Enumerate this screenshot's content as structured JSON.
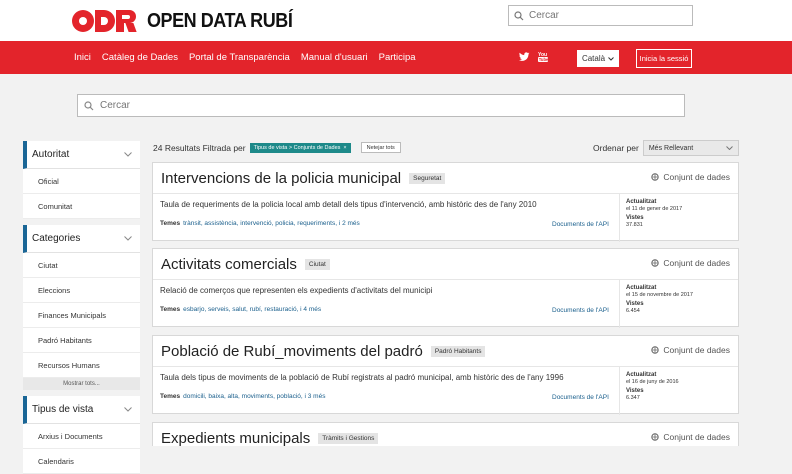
{
  "header": {
    "logo_text": "OPEN DATA RUBÍ",
    "search_placeholder": "Cercar"
  },
  "nav": {
    "items": [
      "Inici",
      "Catàleg de Dades",
      "Portal de Transparència",
      "Manual d'usuari",
      "Participa"
    ],
    "language": "Català",
    "login": "Inicia la sessió"
  },
  "main_search": {
    "placeholder": "Cercar"
  },
  "sidebar": {
    "facets": [
      {
        "title": "Autoritat",
        "items": [
          "Oficial",
          "Comunitat"
        ]
      },
      {
        "title": "Categories",
        "items": [
          "Ciutat",
          "Eleccions",
          "Finances Municipals",
          "Padró Habitants",
          "Recursos Humans"
        ],
        "show_all": "Mostrar tots..."
      },
      {
        "title": "Tipus de vista",
        "items": [
          "Arxius i Documents",
          "Calendaris"
        ]
      }
    ]
  },
  "results": {
    "count_text": "24 Resultats Filtrada per",
    "filter_chip": "Tipus de vista > Conjunts de Dades",
    "clear_label": "Netejar tots",
    "order_label": "Ordenar per",
    "order_value": "Més Rellevant"
  },
  "cards": [
    {
      "title": "Intervencions de la policia municipal",
      "tag": "Seguretat",
      "type": "Conjunt de dades",
      "description": "Taula de requeriments de la policia local amb detall dels tipus d'intervenció, amb històric des de l'any 2010",
      "temes_label": "Temes",
      "temes": "trànsit, assistència, intervenció, policia, requeriments, i 2 més",
      "api": "Documents de l'API",
      "updated_label": "Actualitzat",
      "updated": "el 11 de gener de 2017",
      "views_label": "Vistes",
      "views": "37.831"
    },
    {
      "title": "Activitats comercials",
      "tag": "Ciutat",
      "type": "Conjunt de dades",
      "description": "Relació de comerços que representen els expedients d'activitats del municipi",
      "temes_label": "Temes",
      "temes": "esbarjo, serveis, salut, rubí, restauració, i 4 més",
      "api": "Documents de l'API",
      "updated_label": "Actualitzat",
      "updated": "el 15 de novembre de 2017",
      "views_label": "Vistes",
      "views": "6.454"
    },
    {
      "title": "Població de Rubí_moviments del padró",
      "tag": "Padró Habitants",
      "type": "Conjunt de dades",
      "description": "Taula dels tipus de moviments de la població de Rubí registrats al padró municipal, amb històric des de l'any 1996",
      "temes_label": "Temes",
      "temes": "domicili, baixa, alta, moviments, població, i 3 més",
      "api": "Documents de l'API",
      "updated_label": "Actualitzat",
      "updated": "el 16 de juny de 2016",
      "views_label": "Vistes",
      "views": "6.347"
    },
    {
      "title": "Expedients municipals",
      "tag": "Tràmits i Gestions",
      "type": "Conjunt de dades"
    }
  ],
  "colors": {
    "brand_red": "#e3242b",
    "facet_accent": "#1a6696",
    "chip_teal": "#1e8a8a",
    "link_blue": "#1a5f8c"
  }
}
